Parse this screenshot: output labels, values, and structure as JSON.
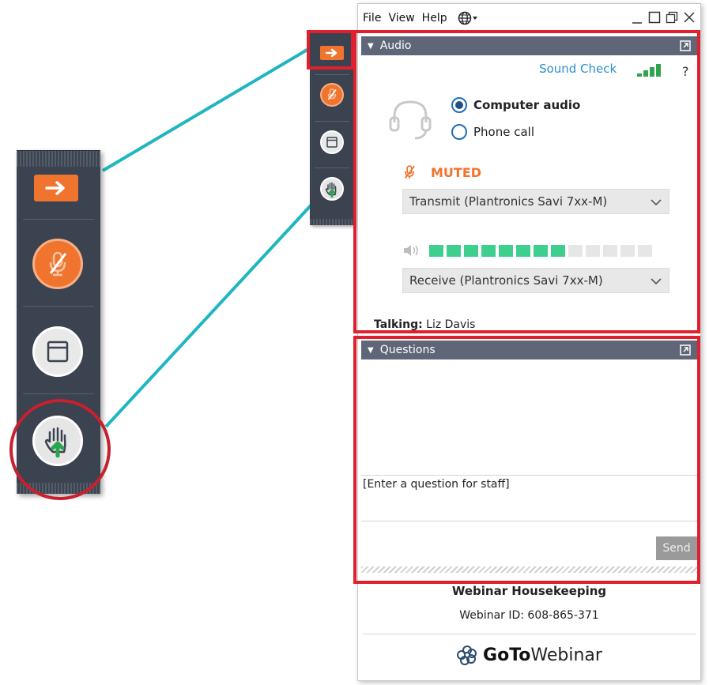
{
  "menu": {
    "file": "File",
    "view": "View",
    "help": "Help"
  },
  "audio_panel": {
    "title": "Audio",
    "sound_check": "Sound Check",
    "help": "?",
    "computer_audio": "Computer audio",
    "phone_call": "Phone call",
    "selected_option": "Computer audio",
    "muted": "MUTED",
    "transmit_device": "Transmit (Plantronics Savi 7xx-M)",
    "receive_device": "Receive (Plantronics Savi 7xx-M)",
    "input_level_segments_lit": 8,
    "input_level_segments_total": 13,
    "talking_label": "Talking:",
    "talking_name": "Liz Davis"
  },
  "questions_panel": {
    "title": "Questions",
    "placeholder": "[Enter a question for staff]",
    "send_label": "Send"
  },
  "footer": {
    "title": "Webinar Housekeeping",
    "webinar_id": "Webinar ID: 608-865-371",
    "brand_bold": "GoTo",
    "brand_rest": "Webinar"
  },
  "colors": {
    "accent_orange": "#f0742d",
    "highlight_red": "#e0202d",
    "panel_header": "#5e6677",
    "toolbar_bg": "#3b4250",
    "connector": "#1fb6c1",
    "link_blue": "#2a8fd0",
    "meter_green": "#3ecf8e"
  },
  "icons": {
    "toolbar": [
      "arrow-right-icon",
      "mic-muted-icon",
      "window-icon",
      "raise-hand-icon"
    ],
    "menu": [
      "globe-icon"
    ],
    "panel": [
      "popout-icon",
      "headset-icon",
      "speaker-icon",
      "chevron-down-icon"
    ]
  }
}
